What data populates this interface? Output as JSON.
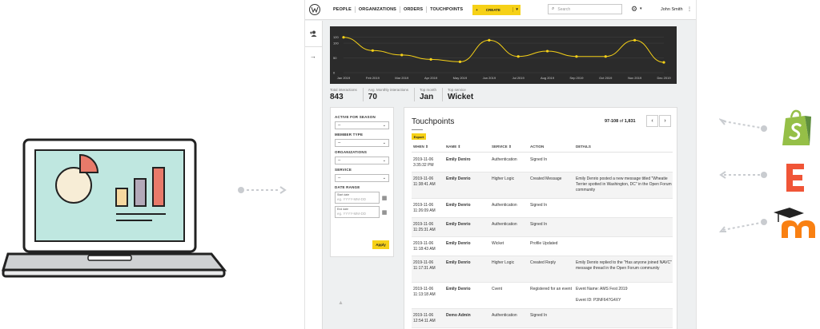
{
  "nav": {
    "items": [
      "PEOPLE",
      "ORGANIZATIONS",
      "ORDERS",
      "TOUCHPOINTS"
    ],
    "create_label": "CREATE",
    "create_plus": "+",
    "create_caret": "▾"
  },
  "search": {
    "placeholder": "Search"
  },
  "user": {
    "name": "John Smith"
  },
  "chart_data": {
    "type": "line",
    "categories": [
      "Jan 2019",
      "Feb 2019",
      "Mar 2019",
      "Apr 2019",
      "May 2019",
      "Jun 2019",
      "Jul 2019",
      "Aug 2019",
      "Sep 2019",
      "Oct 2019",
      "Nov 2019",
      "Dec 2019"
    ],
    "series": [
      {
        "values": [
          120,
          75,
          60,
          45,
          37,
          110,
          55,
          73,
          55,
          55,
          110,
          35
        ]
      }
    ],
    "yticks": [
      "120",
      "100",
      "50",
      "0"
    ],
    "ylim": [
      0,
      130
    ],
    "grid": true,
    "line_color": "#f6d117",
    "background": "#2b2b2b"
  },
  "stats": [
    {
      "label": "Total interactions",
      "value": "843"
    },
    {
      "label": "Avg. Monthly interactions",
      "value": "70"
    },
    {
      "label": "Top month",
      "value": "Jan"
    },
    {
      "label": "Top service",
      "value": "Wicket"
    }
  ],
  "filters": {
    "active_for_season": {
      "label": "ACTIVE FOR SEASON",
      "value": "--"
    },
    "member_type": {
      "label": "MEMBER TYPE",
      "value": "--"
    },
    "organizations": {
      "label": "ORGANIZATIONS",
      "value": "--"
    },
    "service": {
      "label": "SERVICE",
      "value": "--"
    },
    "date_range_label": "DATE RANGE",
    "start_date": {
      "title": "Start date",
      "placeholder": "eg. YYYY-MM-DD"
    },
    "end_date": {
      "title": "End date",
      "placeholder": "eg. YYYY-MM-DD"
    },
    "apply_label": "Apply"
  },
  "touchpoints": {
    "title": "Touchpoints",
    "export_label": "Export",
    "pager_range": "97-108",
    "pager_of": "of",
    "pager_total": "1,831",
    "columns": [
      "WHEN",
      "NAME",
      "SERVICE",
      "ACTION",
      "DETAILS"
    ],
    "rows": [
      {
        "when": "2019-11-06\n3:35:32 PM",
        "name": "Emily Deniro",
        "service": "Authentication",
        "action": "Signed In",
        "details": ""
      },
      {
        "when": "2019-11-06\n11:38:41 AM",
        "name": "Emily Denrio",
        "service": "Higher Logic",
        "action": "Created Message",
        "details": "Emily Denrio posted a new message titled \"Wheatie Terrier spotted in Washington, DC\" in the Open Forum community"
      },
      {
        "when": "2019-11-06\n11:26:09 AM",
        "name": "Emily Denrio",
        "service": "Authentication",
        "action": "Signed In",
        "details": ""
      },
      {
        "when": "2019-11-06\n11:25:31 AM",
        "name": "Emily Denrio",
        "service": "Authentication",
        "action": "Signed In",
        "details": ""
      },
      {
        "when": "2019-11-06\n11:18:43 AM",
        "name": "Emily Denrio",
        "service": "Wicket",
        "action": "Profile Updated",
        "details": ""
      },
      {
        "when": "2019-11-06\n11:17:31 AM",
        "name": "Emily Denrio",
        "service": "Higher Logic",
        "action": "Created Reply",
        "details": "Emily Denrio replied to the \"Has anyone joined NAVC\" message thread in the Open Forum community"
      },
      {
        "when": "2019-11-06\n11:13:18 AM",
        "name": "Emily Denrio",
        "service": "Cvent",
        "action": "Registered for an event",
        "details": "Event Name: AMS Fest 2019\n\nEvent ID: P3NF647G4XY"
      },
      {
        "when": "2019-11-06\n12:54:11 AM",
        "name": "Demo Admin",
        "service": "Authentication",
        "action": "Signed In",
        "details": ""
      }
    ]
  },
  "colors": {
    "accent": "#f6d117",
    "shopify": "#95bf47",
    "eventbrite": "#f05537",
    "moodle": "#f98012"
  },
  "icons": {
    "add_user": "add-user-icon",
    "arrow_right": "arrow-right-icon",
    "search": "search-icon",
    "gear": "gear-icon",
    "more": "more-vertical-icon",
    "calendar": "calendar-icon"
  }
}
